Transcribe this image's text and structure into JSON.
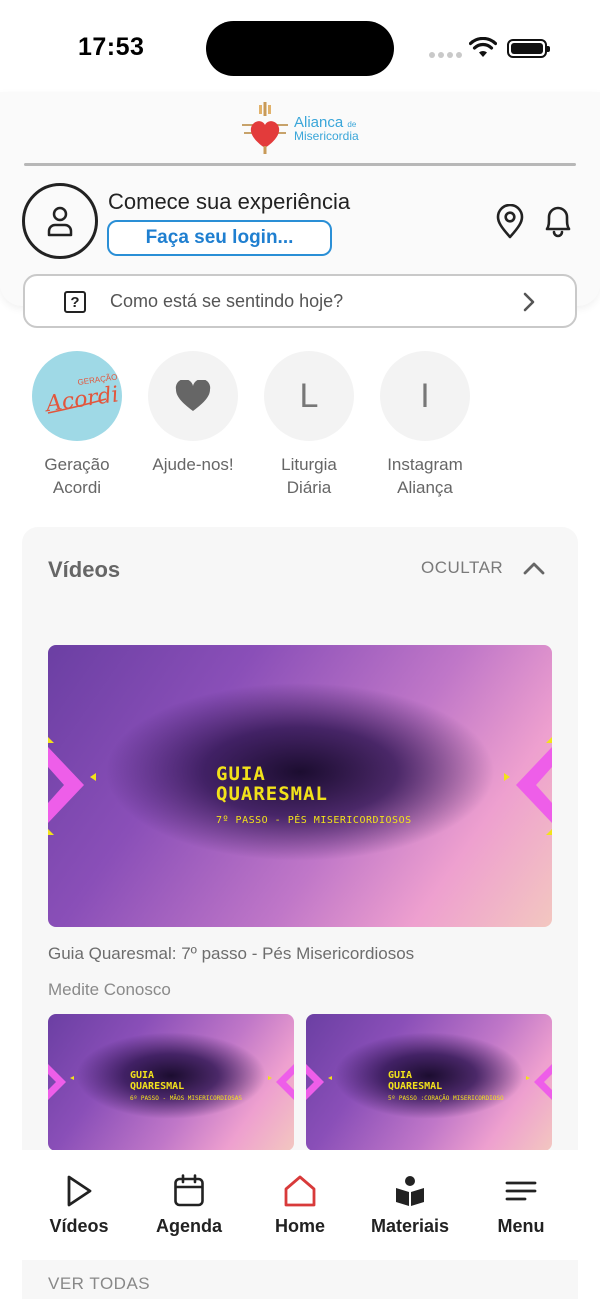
{
  "status_bar": {
    "time": "17:53"
  },
  "header": {
    "logo": {
      "line1": "Alianca",
      "line1_small": "de",
      "line2": "Misericordia"
    },
    "welcome": "Comece sua experiência",
    "login_button": "Faça seu login...",
    "mood_prompt": "Como está se sentindo hoje?",
    "mood_icon_glyph": "?"
  },
  "shortcuts": [
    {
      "label": "Geração\nAcordi",
      "icon": "geracao-acordi-logo"
    },
    {
      "label": "Ajude-nos!",
      "icon": "heart-icon"
    },
    {
      "label": "Liturgia\nDiária",
      "initial": "L"
    },
    {
      "label": "Instagram\nAliança",
      "initial": "I"
    }
  ],
  "videos": {
    "title": "Vídeos",
    "hide_label": "OCULTAR",
    "featured": {
      "thumb_title_1": "GUIA",
      "thumb_title_2": "QUARESMAL",
      "thumb_subtitle": "7º PASSO - PÉS MISERICORDIOSOS",
      "caption": "Guia Quaresmal: 7º passo - Pés Misericordiosos"
    },
    "category": "Medite Conosco",
    "items": [
      {
        "thumb_title_1": "GUIA",
        "thumb_title_2": "QUARESMAL",
        "thumb_subtitle": "6º PASSO - MÃOS MISERICORDIOSAS"
      },
      {
        "thumb_title_1": "GUIA",
        "thumb_title_2": "QUARESMAL",
        "thumb_subtitle": "5º PASSO :CORAÇÃO MISERICORDIOSO"
      }
    ],
    "view_all": "VER TODAS"
  },
  "tab_bar": {
    "tabs": [
      {
        "label": "Vídeos",
        "icon": "play-icon"
      },
      {
        "label": "Agenda",
        "icon": "calendar-icon"
      },
      {
        "label": "Home",
        "icon": "home-icon",
        "active": true
      },
      {
        "label": "Materiais",
        "icon": "book-icon"
      },
      {
        "label": "Menu",
        "icon": "menu-icon"
      }
    ]
  },
  "colors": {
    "accent": "#2a8fd6",
    "home_active": "#d83a3a",
    "thumb_text": "#f2e21a",
    "heart": "#e63535"
  }
}
